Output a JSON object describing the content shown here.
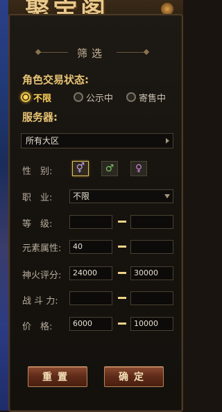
{
  "header": {
    "title": "聚宝阁"
  },
  "filter": {
    "title": "筛选"
  },
  "trade_status": {
    "label": "角色交易状态:",
    "options": [
      {
        "label": "不限",
        "selected": true
      },
      {
        "label": "公示中",
        "selected": false
      },
      {
        "label": "寄售中",
        "selected": false
      }
    ]
  },
  "server": {
    "label": "服务器:",
    "value": "所有大区"
  },
  "gender": {
    "label": "性　别:",
    "options": [
      "both-gender-icon",
      "male-icon",
      "female-icon"
    ],
    "selected": 0
  },
  "job": {
    "label": "职　业:",
    "value": "不限"
  },
  "level": {
    "label": "等　级:",
    "min": "",
    "max": ""
  },
  "element": {
    "label": "元素属性:",
    "min": "40",
    "max": ""
  },
  "fire_score": {
    "label": "神火评分:",
    "min": "24000",
    "max": "30000"
  },
  "power": {
    "label": "战 斗 力:",
    "min": "",
    "max": ""
  },
  "price": {
    "label": "价　格:",
    "min": "6000",
    "max": "10000"
  },
  "buttons": {
    "reset": "重置",
    "confirm": "确定"
  },
  "colors": {
    "accent": "#e8c474",
    "selected_radio": "#ffd15a",
    "button": "#6a3420"
  }
}
